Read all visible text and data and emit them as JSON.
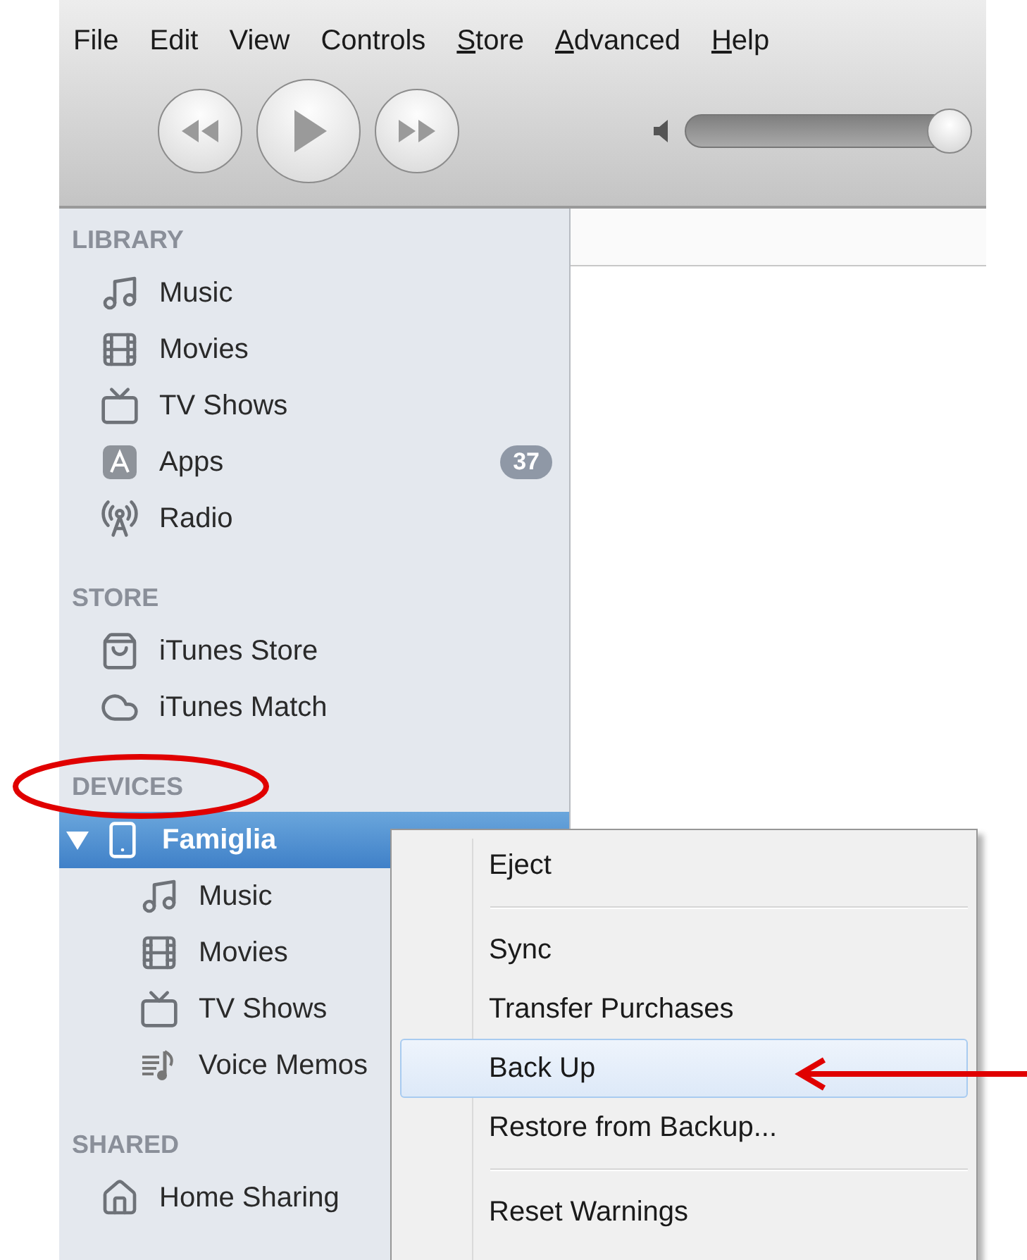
{
  "menu_bar": [
    {
      "label": "File",
      "underlined": false
    },
    {
      "label": "Edit",
      "underlined": false
    },
    {
      "label": "View",
      "underlined": false
    },
    {
      "label": "Controls",
      "underlined": false
    },
    {
      "label": "Store",
      "underlined": true
    },
    {
      "label": "Advanced",
      "underlined": true
    },
    {
      "label": "Help",
      "underlined": true
    }
  ],
  "volume": {
    "level": 0.96
  },
  "sidebar": {
    "sections": [
      {
        "title": "LIBRARY",
        "items": [
          {
            "label": "Music",
            "selected": false
          },
          {
            "label": "Movies",
            "selected": false
          },
          {
            "label": "TV Shows",
            "selected": false
          },
          {
            "label": "Apps",
            "selected": false,
            "badge": "37"
          },
          {
            "label": "Radio",
            "selected": false
          }
        ]
      },
      {
        "title": "STORE",
        "items": [
          {
            "label": "iTunes Store",
            "selected": false
          },
          {
            "label": "iTunes Match",
            "selected": false
          }
        ]
      },
      {
        "title": "DEVICES",
        "items": [
          {
            "label": "Famiglia",
            "selected": true,
            "expanded": true,
            "children": [
              {
                "label": "Music",
                "selected": false
              },
              {
                "label": "Movies",
                "selected": false
              },
              {
                "label": "TV Shows",
                "selected": false
              },
              {
                "label": "Voice Memos",
                "selected": false
              }
            ]
          }
        ]
      },
      {
        "title": "SHARED",
        "items": [
          {
            "label": "Home Sharing",
            "selected": false
          }
        ]
      }
    ]
  },
  "context_menu": {
    "groups": [
      [
        {
          "label": "Eject",
          "selected": false
        }
      ],
      [
        {
          "label": "Sync",
          "selected": false
        },
        {
          "label": "Transfer Purchases",
          "selected": false
        },
        {
          "label": "Back Up",
          "selected": true
        },
        {
          "label": "Restore from Backup...",
          "selected": false
        }
      ],
      [
        {
          "label": "Reset Warnings",
          "selected": false
        }
      ]
    ]
  },
  "annotations": [
    {
      "kind": "ellipse"
    },
    {
      "kind": "arrow"
    }
  ]
}
